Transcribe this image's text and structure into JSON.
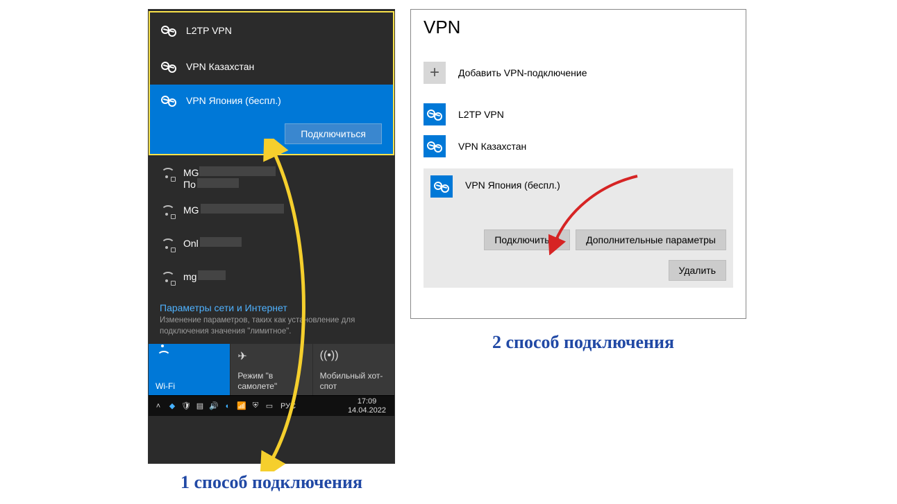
{
  "flyout": {
    "vpn_items": [
      {
        "label": "L2TP VPN"
      },
      {
        "label": "VPN Казахстан"
      },
      {
        "label": "VPN Япония (беспл.)"
      }
    ],
    "connect_label": "Подключиться",
    "wifi_items": [
      {
        "prefix": "MG",
        "sub": "По"
      },
      {
        "prefix": "MG"
      },
      {
        "prefix": "Onl"
      },
      {
        "prefix": "mg"
      }
    ],
    "net_settings_title": "Параметры сети и Интернет",
    "net_settings_desc": "Изменение параметров, таких как установление для подключения значения \"лимитное\".",
    "tiles": {
      "wifi": "Wi-Fi",
      "airplane": "Режим \"в самолете\"",
      "hotspot": "Мобильный хот-спот"
    },
    "taskbar": {
      "lang": "РУС",
      "time": "17:09",
      "date": "14.04.2022"
    }
  },
  "settings": {
    "title": "VPN",
    "add_label": "Добавить VPN-подключение",
    "items": [
      {
        "label": "L2TP VPN"
      },
      {
        "label": "VPN Казахстан"
      },
      {
        "label": "VPN Япония (беспл.)"
      }
    ],
    "btn_connect": "Подключиться",
    "btn_advanced": "Дополнительные параметры",
    "btn_delete": "Удалить"
  },
  "captions": {
    "left": "1 способ подключения",
    "right": "2 способ подключения"
  }
}
